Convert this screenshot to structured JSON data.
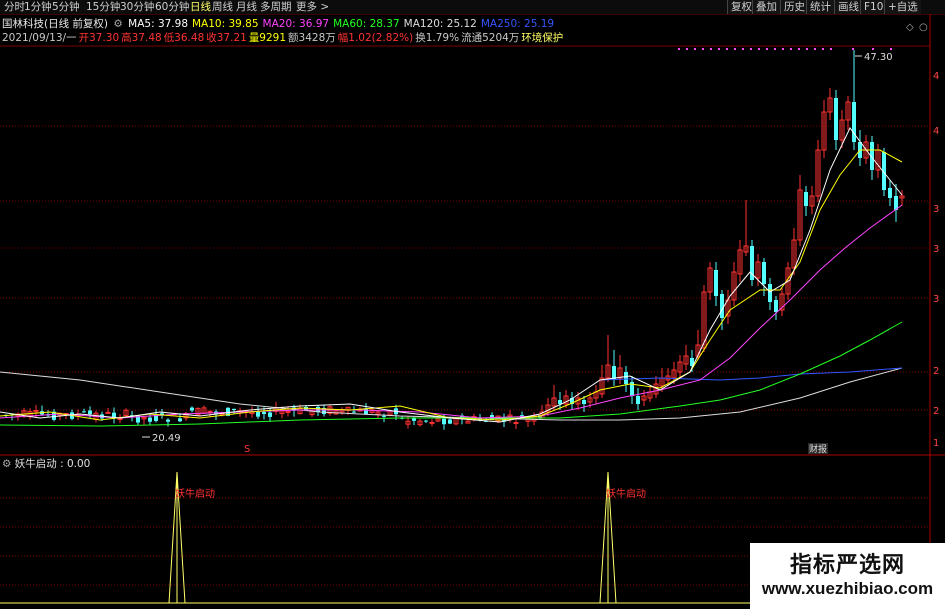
{
  "toolbar": {
    "periods": [
      "分时",
      "1分钟",
      "5分钟",
      "15分钟",
      "30分钟",
      "60分钟",
      "日线",
      "周线",
      "月线",
      "多周期",
      "更多 >"
    ],
    "active_period": "日线",
    "right_buttons": [
      "复权",
      "叠加",
      "历史",
      "统计",
      "画线",
      "F10",
      "+自选"
    ]
  },
  "header": {
    "stock_name": "国林科技(日线 前复权)",
    "ma_labels": [
      {
        "text": "MA5: 37.98",
        "color": "#ffffff"
      },
      {
        "text": "MA10: 39.85",
        "color": "#ffff00"
      },
      {
        "text": "MA20: 36.97",
        "color": "#ff44ff"
      },
      {
        "text": "MA60: 28.37",
        "color": "#22ff22"
      },
      {
        "text": "MA120: 25.12",
        "color": "#dddddd"
      },
      {
        "text": "MA250: 25.19",
        "color": "#3355ff"
      }
    ],
    "bar_info": [
      {
        "text": "2021/09/13/一",
        "color": "#c8c8c8"
      },
      {
        "text": "开37.30",
        "color": "#ff3333"
      },
      {
        "text": "高37.48",
        "color": "#ff3333"
      },
      {
        "text": "低36.48",
        "color": "#ff3333"
      },
      {
        "text": "收37.21",
        "color": "#ff3333"
      },
      {
        "text": "量9291",
        "color": "#ffff00"
      },
      {
        "text": "额3428万",
        "color": "#c8c8c8"
      },
      {
        "text": "幅1.02(2.82%)",
        "color": "#ff3333"
      },
      {
        "text": "换1.79%",
        "color": "#c8c8c8"
      },
      {
        "text": "流通5204万",
        "color": "#c8c8c8"
      },
      {
        "text": "环境保护",
        "color": "#ffff66"
      }
    ]
  },
  "main_chart": {
    "high_label": "47.30",
    "low_label": "20.49",
    "marker_s": "S",
    "marker_report": "财报",
    "right_axis_labels": [
      "4",
      "4",
      "3",
      "3",
      "3",
      "2",
      "2",
      "1"
    ]
  },
  "indicator": {
    "title": "妖牛启动 : 0.00",
    "signal_label": "妖牛启动",
    "signal_count": 2
  },
  "watermark": {
    "title": "指标严选网",
    "url": "www.xuezhibiao.com"
  },
  "colors": {
    "up": "#ff3232",
    "down": "#54ffff",
    "grid": "#7a0000",
    "ma5": "#ffffff",
    "ma10": "#ffff00",
    "ma20": "#ff44ff",
    "ma60": "#22ff22",
    "ma120": "#dddddd",
    "ma250": "#3355ff"
  }
}
